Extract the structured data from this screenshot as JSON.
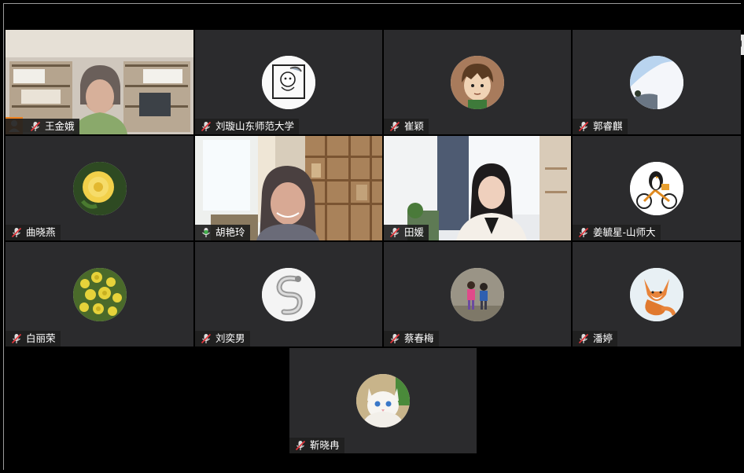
{
  "participants": [
    {
      "name": "王金娥",
      "type": "video",
      "host": true,
      "mic": "muted"
    },
    {
      "name": "刘璇山东师范大学",
      "type": "avatar",
      "avatar_icon": "bird-cartoon-icon",
      "mic": "muted"
    },
    {
      "name": "崔颖",
      "type": "avatar",
      "avatar_icon": "anime-boy-icon",
      "mic": "muted"
    },
    {
      "name": "郭睿麒",
      "type": "avatar",
      "avatar_icon": "snowy-mountain-icon",
      "mic": "muted"
    },
    {
      "name": "曲晓燕",
      "type": "avatar",
      "avatar_icon": "yellow-rose-icon",
      "mic": "muted"
    },
    {
      "name": "胡艳玲",
      "type": "video",
      "active_speaker": true,
      "mic": "speaking"
    },
    {
      "name": "田媛",
      "type": "video",
      "mic": "muted"
    },
    {
      "name": "姜毓星-山师大",
      "type": "avatar",
      "avatar_icon": "penguin-bicycle-icon",
      "mic": "muted"
    },
    {
      "name": "白丽荣",
      "type": "avatar",
      "avatar_icon": "yellow-flowers-icon",
      "mic": "muted"
    },
    {
      "name": "刘奕男",
      "type": "avatar",
      "avatar_icon": "silver-snake-icon",
      "mic": "muted"
    },
    {
      "name": "蔡春梅",
      "type": "avatar",
      "avatar_icon": "children-playing-icon",
      "mic": "muted"
    },
    {
      "name": "潘婷",
      "type": "avatar",
      "avatar_icon": "fox-painting-icon",
      "mic": "muted"
    },
    {
      "name": "靳晓冉",
      "type": "avatar",
      "avatar_icon": "white-cat-icon",
      "mic": "muted"
    }
  ],
  "colors": {
    "tile_bg": "#2b2b2d",
    "active_speaker": "#3fae4a",
    "host_badge": "#f0821e",
    "muted_mic": "#e0353b"
  }
}
